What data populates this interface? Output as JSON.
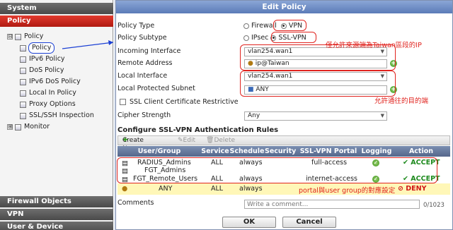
{
  "sidebar": {
    "sections": [
      "System",
      "Policy"
    ],
    "bottom_sections": [
      "Firewall Objects",
      "VPN",
      "User & Device"
    ],
    "tree": [
      {
        "label": "Policy",
        "expander": "⊟"
      },
      {
        "label": "Policy"
      },
      {
        "label": "IPv6 Policy"
      },
      {
        "label": "DoS Policy"
      },
      {
        "label": "IPv6 DoS Policy"
      },
      {
        "label": "Local In Policy"
      },
      {
        "label": "Proxy Options"
      },
      {
        "label": "SSL/SSH Inspection"
      },
      {
        "label": "Monitor",
        "expander": "⊞"
      }
    ]
  },
  "dialog": {
    "title": "Edit Policy",
    "policy_type": {
      "label": "Policy Type",
      "options": [
        "Firewall",
        "VPN"
      ],
      "selected": "VPN"
    },
    "policy_subtype": {
      "label": "Policy Subtype",
      "options": [
        "IPsec",
        "SSL-VPN"
      ],
      "selected": "SSL-VPN"
    },
    "incoming_interface": {
      "label": "Incoming Interface",
      "value": "vlan254.wan1"
    },
    "remote_address": {
      "label": "Remote Address",
      "value": "ip@Taiwan"
    },
    "local_interface": {
      "label": "Local Interface",
      "value": "vlan254.wan1"
    },
    "local_subnet": {
      "label": "Local Protected Subnet",
      "value": "ANY"
    },
    "ssl_cert": {
      "label": "SSL Client Certificate Restrictive"
    },
    "cipher": {
      "label": "Cipher Strength",
      "value": "Any"
    },
    "auth_rules_title": "Configure SSL-VPN Authentication Rules",
    "toolbar": {
      "create": "Create New",
      "edit": "Edit",
      "delete": "Delete"
    },
    "columns": [
      "User/Group",
      "Service",
      "Schedule",
      "Security",
      "SSL-VPN Portal",
      "Logging",
      "Action"
    ],
    "rows": [
      {
        "users": [
          "RADIUS_Admins",
          "FGT_Admins"
        ],
        "service": "ALL",
        "schedule": "always",
        "security": "",
        "portal": "full-access",
        "action": "ACCEPT"
      },
      {
        "users": [
          "FGT_Remote_Users"
        ],
        "service": "ALL",
        "schedule": "always",
        "security": "",
        "portal": "internet-access",
        "action": "ACCEPT"
      },
      {
        "users": [
          "ANY"
        ],
        "service": "ALL",
        "schedule": "always",
        "security": "",
        "portal": "",
        "action": "DENY"
      }
    ],
    "comments": {
      "label": "Comments",
      "placeholder": "Write a comment...",
      "counter": "0/1023"
    },
    "ok": "OK",
    "cancel": "Cancel"
  },
  "annotations": {
    "remote_note": "僅允許來源端為Taiwan區段的IP",
    "subnet_note": "允許通往的目的端",
    "portal_note": "portal與user group的對應設定"
  },
  "colors": {
    "accent_red": "#e0231e",
    "blue_select": "#1a3fd4",
    "accept": "#1e8a1e",
    "deny": "#d01515",
    "deny_row": "#fff7b8"
  }
}
